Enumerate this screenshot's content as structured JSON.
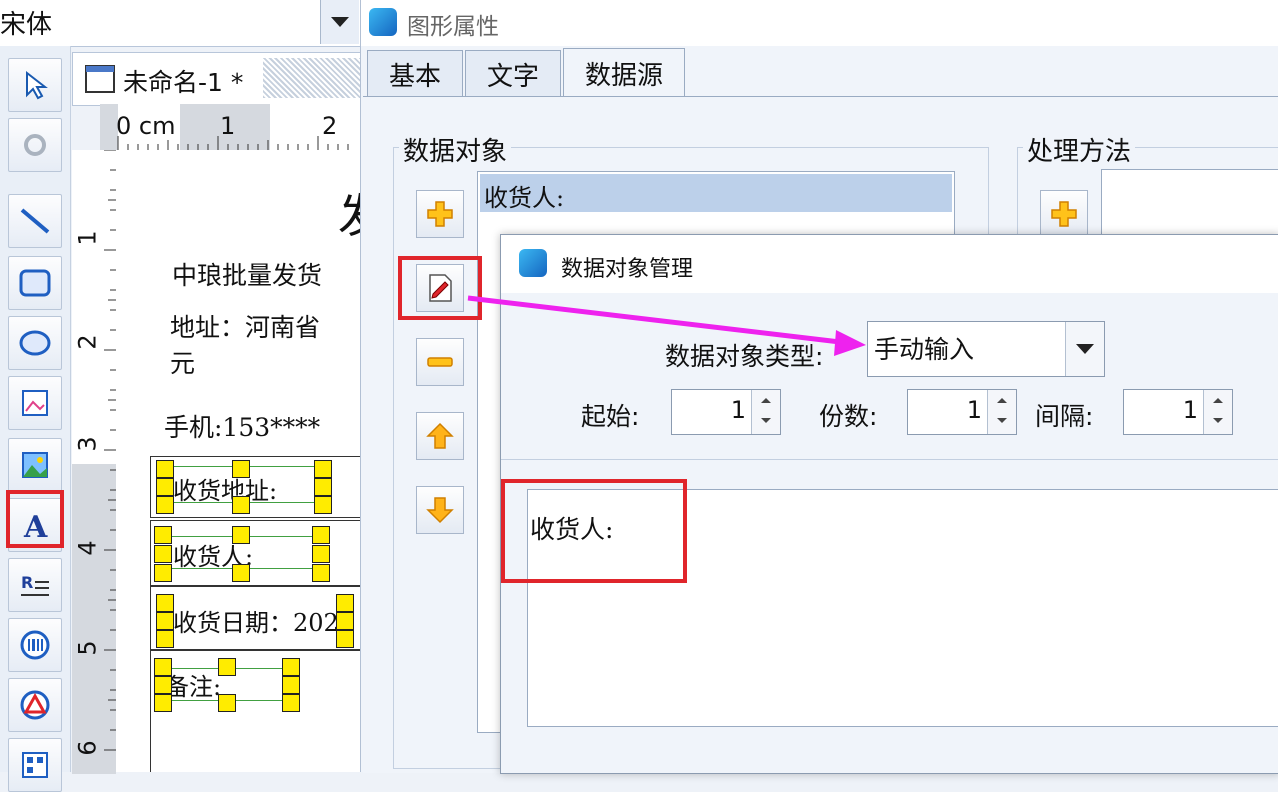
{
  "font_selector": {
    "value": "宋体"
  },
  "document": {
    "tab_title": "未命名-1 *"
  },
  "ruler": {
    "h_ticks": [
      "0 cm",
      "1",
      "2"
    ],
    "v_ticks": [
      "1",
      "2",
      "3",
      "4",
      "5",
      "6"
    ]
  },
  "label_canvas": {
    "title_char": "发",
    "line1": "中琅批量发货",
    "line2": "地址：河南省",
    "line2b": "元",
    "line3": "手机:153****",
    "cells": [
      "收货地址:",
      "收货人:",
      "收货日期：202",
      "备注:"
    ]
  },
  "dialog": {
    "title": "图形属性",
    "tabs": [
      "基本",
      "文字",
      "数据源"
    ],
    "active_tab": "数据源",
    "data_object_group": "数据对象",
    "process_group": "处理方法",
    "data_object_items": [
      "收货人:"
    ]
  },
  "inner_dialog": {
    "title": "数据对象管理",
    "type_label": "数据对象类型:",
    "type_value": "手动输入",
    "start_label": "起始:",
    "start_value": "1",
    "copies_label": "份数:",
    "copies_value": "1",
    "interval_label": "间隔:",
    "interval_value": "1",
    "content": "收货人:"
  },
  "colors": {
    "highlight": "#e0252b",
    "arrow": "#ee22ee",
    "selection": "#bcd0ea"
  }
}
